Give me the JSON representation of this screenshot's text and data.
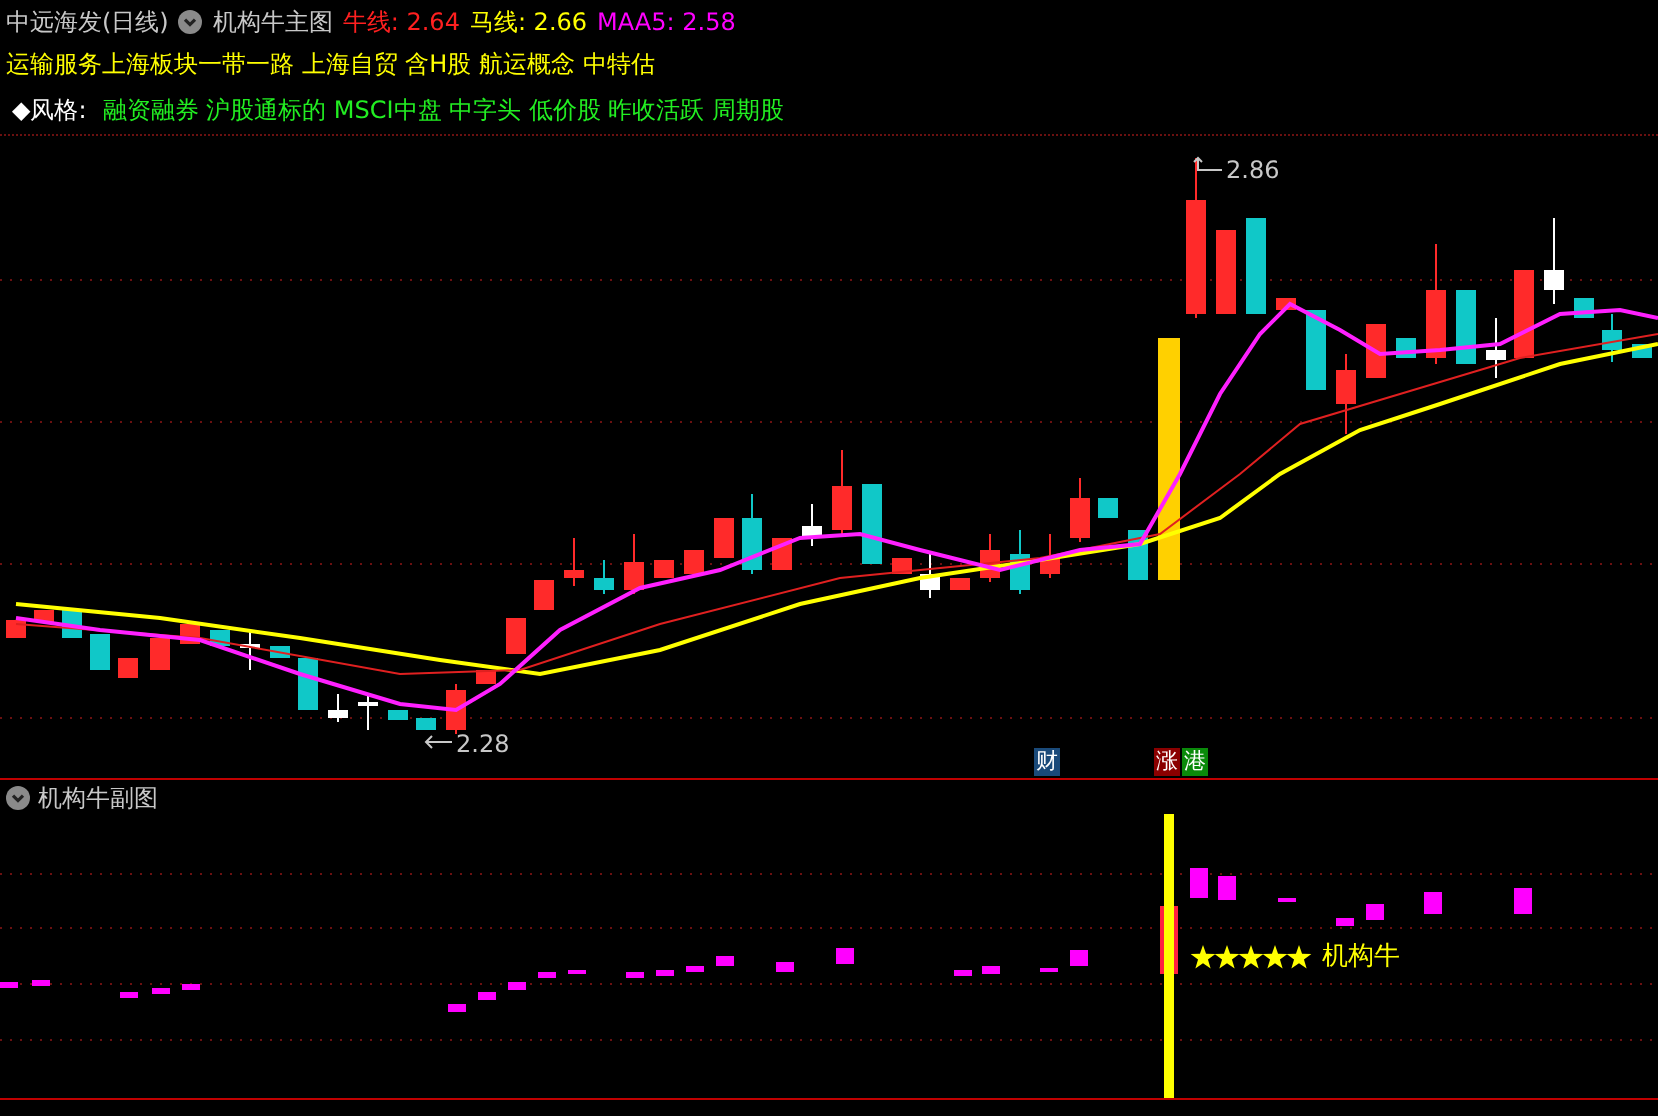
{
  "header": {
    "title": "中远海发(日线)",
    "indicator_name": "机构牛主图",
    "readings": [
      {
        "label": "牛线: 2.64",
        "color": "#ff2020"
      },
      {
        "label": "马线: 2.66",
        "color": "#ffff00"
      },
      {
        "label": "MAA5: 2.58",
        "color": "#ff00ff"
      }
    ]
  },
  "concepts": "运输服务上海板块一带一路 上海自贸 含H股 航运概念 中特估",
  "style": {
    "label": "◆风格:",
    "tags": "融资融券 沪股通标的 MSCI中盘 中字头 低价股 昨收活跃 周期股"
  },
  "main_chart": {
    "high_label": "2.86",
    "low_label": "2.28",
    "badges": [
      {
        "text": "财",
        "color": "#1a4a7a"
      },
      {
        "text": "涨",
        "color": "#8b0000"
      },
      {
        "text": "港",
        "color": "#0a8a0a"
      }
    ]
  },
  "sub_chart": {
    "title": "机构牛副图",
    "signal": {
      "stars": 5,
      "label": "机构牛"
    }
  }
}
